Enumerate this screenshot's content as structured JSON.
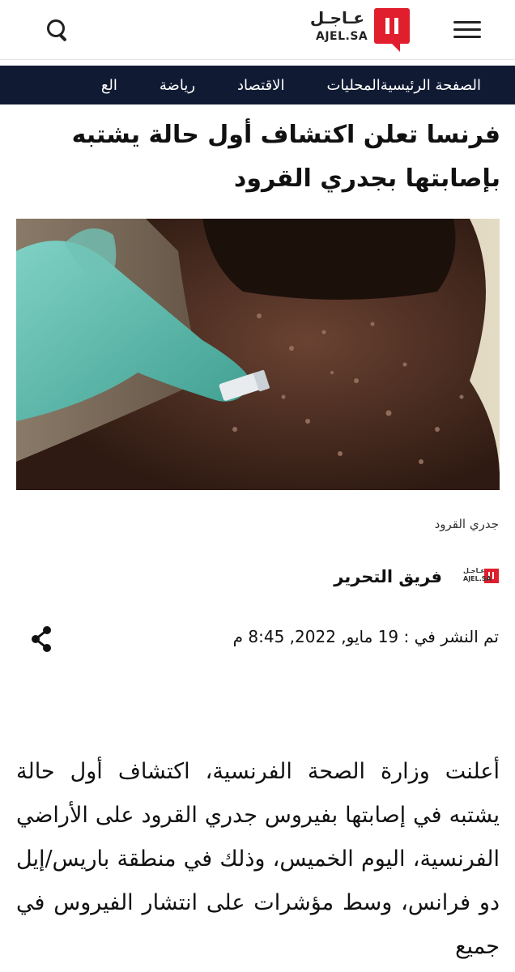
{
  "header": {
    "logo_arabic": "عـاجـل",
    "logo_latin": "AJEL.SA"
  },
  "nav": {
    "items": [
      "الصفحة الرئيسية",
      "المحليات",
      "الاقتصاد",
      "رياضة",
      "الع"
    ]
  },
  "article": {
    "headline": "فرنسا تعلن اكتشاف أول حالة يشتبه بإصابتها بجدري القرود",
    "image_caption": "جدري القرود",
    "author": {
      "logo_arabic": "عـاجـل",
      "logo_latin": "AJEL.SA",
      "name": "فريق التحرير"
    },
    "published": "تم النشر في : 19 مايو, 2022, 8:45 م",
    "body": "أعلنت وزارة الصحة الفرنسية، اكتشاف أول حالة يشتبه في إصابتها بفيروس جدري القرود على الأراضي الفرنسية، اليوم الخميس، وذلك في منطقة باريس/إيل دو فرانس، وسط مؤشرات على انتشار الفيروس في جميع"
  },
  "icons": {
    "menu": "hamburger-menu-icon",
    "search": "search-icon",
    "share": "share-icon"
  },
  "colors": {
    "brand_red": "#e01e2d",
    "nav_background": "#101b33",
    "nav_text": "#ffffff"
  }
}
